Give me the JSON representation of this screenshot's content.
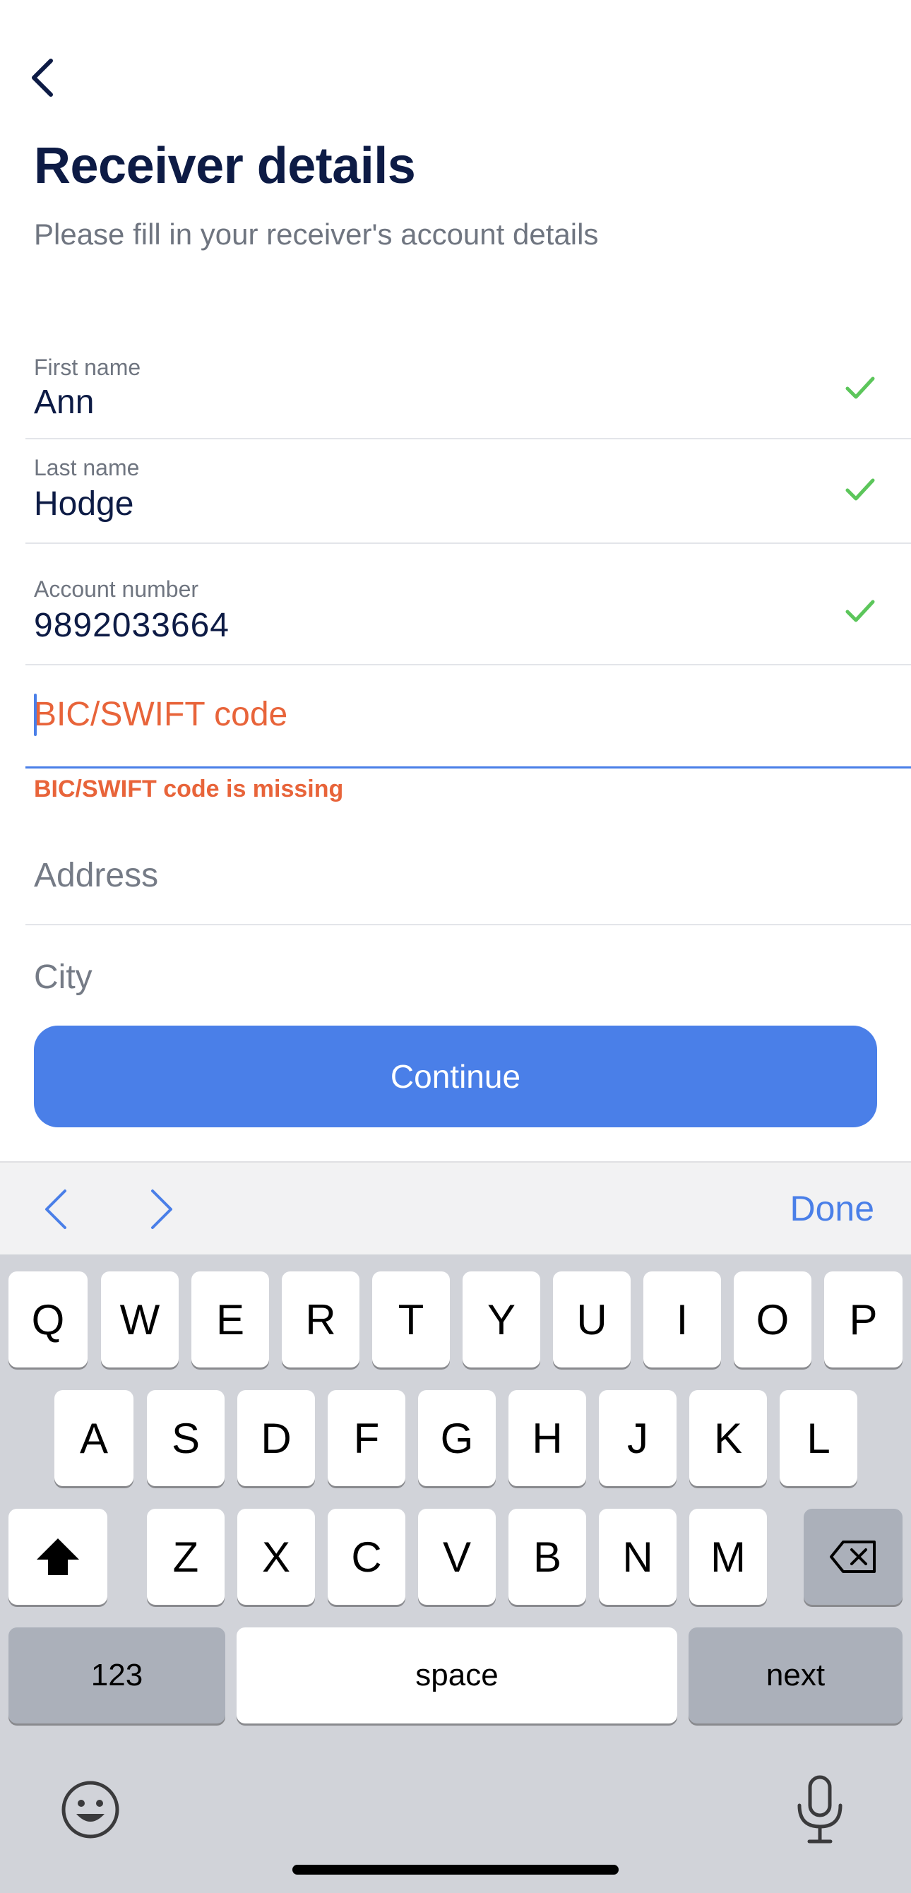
{
  "header": {
    "back_icon": "chevron-left-icon",
    "title": "Receiver details",
    "subtitle": "Please fill in your receiver's account details"
  },
  "form": {
    "first_name": {
      "label": "First name",
      "value": "Ann",
      "valid": true
    },
    "last_name": {
      "label": "Last name",
      "value": "Hodge",
      "valid": true
    },
    "account_number": {
      "label": "Account number",
      "value": "9892033664",
      "valid": true
    },
    "bic": {
      "placeholder": "BIC/SWIFT code",
      "value": "",
      "error": "BIC/SWIFT code is missing",
      "focused": true
    },
    "address": {
      "placeholder": "Address",
      "value": ""
    },
    "city": {
      "placeholder": "City",
      "value": ""
    }
  },
  "actions": {
    "continue_label": "Continue"
  },
  "accessory_bar": {
    "done_label": "Done"
  },
  "keyboard": {
    "row1": [
      "Q",
      "W",
      "E",
      "R",
      "T",
      "Y",
      "U",
      "I",
      "O",
      "P"
    ],
    "row2": [
      "A",
      "S",
      "D",
      "F",
      "G",
      "H",
      "J",
      "K",
      "L"
    ],
    "row3": [
      "Z",
      "X",
      "C",
      "V",
      "B",
      "N",
      "M"
    ],
    "numbers_label": "123",
    "space_label": "space",
    "next_label": "next"
  },
  "colors": {
    "primary": "#4a7fe8",
    "error": "#e8643a",
    "success": "#5cc65b",
    "text_dark": "#0d1b45",
    "text_muted": "#6f7580"
  }
}
